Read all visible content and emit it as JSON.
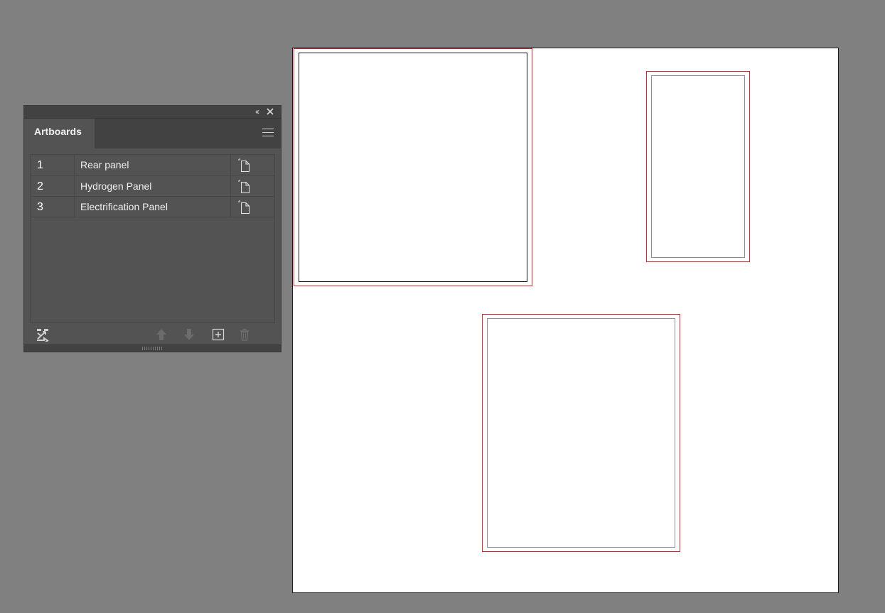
{
  "panel": {
    "collapse_glyph": "‹‹",
    "tab_label": "Artboards",
    "artboards": [
      {
        "number": "1",
        "name": "Rear panel"
      },
      {
        "number": "2",
        "name": "Hydrogen Panel"
      },
      {
        "number": "3",
        "name": "Electrification Panel"
      }
    ],
    "footer_icons": [
      "rearrange-icon",
      "move-up-icon",
      "move-down-icon",
      "new-artboard-icon",
      "delete-icon"
    ]
  },
  "canvas": {
    "background": "#ffffff",
    "frame_color": "#d9232e"
  }
}
